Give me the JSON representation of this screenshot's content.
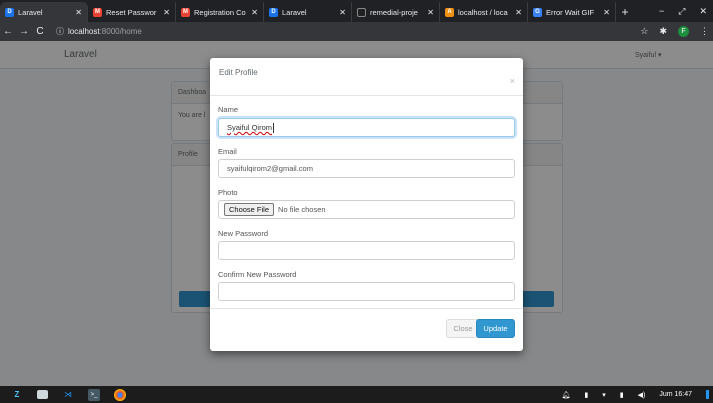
{
  "browser": {
    "tabs": [
      {
        "title": "Laravel",
        "favicon": "laravel-favicon",
        "color": "#1a73e8"
      },
      {
        "title": "Reset Passwor",
        "favicon": "gmail-favicon",
        "color": "#ea4335"
      },
      {
        "title": "Registration Co",
        "favicon": "gmail-favicon",
        "color": "#ea4335"
      },
      {
        "title": "Laravel",
        "favicon": "laravel-favicon",
        "color": "#1a73e8"
      },
      {
        "title": "remedial-proje",
        "favicon": "github-favicon",
        "color": "#202124"
      },
      {
        "title": "localhost / loca",
        "favicon": "phpmyadmin-favicon",
        "color": "#f29111"
      },
      {
        "title": "Error Wait GIF",
        "favicon": "giphy-favicon",
        "color": "#3b82f6"
      }
    ],
    "url_host": "localhost",
    "url_path": ":8000/home",
    "profile_initial": "F"
  },
  "app": {
    "brand": "Laravel",
    "user_menu": "Syaiful ▾",
    "dashboard_heading": "Dashboa",
    "dashboard_body": "You are l",
    "profile_heading": "Profile"
  },
  "modal": {
    "title": "Edit Profile",
    "close_symbol": "×",
    "fields": {
      "name_label": "Name",
      "name_value": "Syaiful Qirom",
      "email_label": "Email",
      "email_value": "syaifulqirom2@gmail.com",
      "photo_label": "Photo",
      "choose_file": "Choose File",
      "no_file": "No file chosen",
      "new_password_label": "New Password",
      "confirm_password_label": "Confirm New Password"
    },
    "close_button": "Close",
    "update_button": "Update"
  },
  "taskbar": {
    "clock": "Jum 16:47"
  }
}
